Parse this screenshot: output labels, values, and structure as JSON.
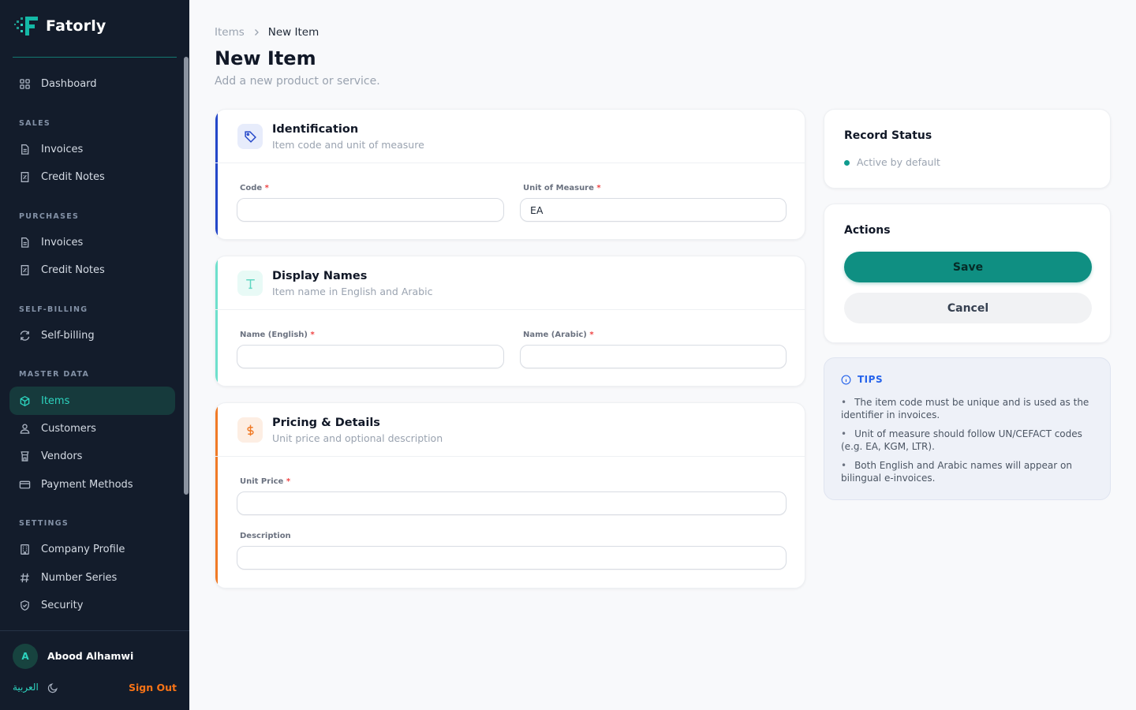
{
  "brand": {
    "name": "Fatorly"
  },
  "sidebar": {
    "dashboard": "Dashboard",
    "sections": {
      "sales": "SALES",
      "purchases": "PURCHASES",
      "self_billing": "SELF-BILLING",
      "master_data": "MASTER DATA",
      "settings": "SETTINGS"
    },
    "sales_items": [
      "Invoices",
      "Credit Notes"
    ],
    "purchase_items": [
      "Invoices",
      "Credit Notes"
    ],
    "self_billing_item": "Self-billing",
    "master_items": [
      "Items",
      "Customers",
      "Vendors",
      "Payment Methods"
    ],
    "settings_items": [
      "Company Profile",
      "Number Series",
      "Security"
    ],
    "active": "Items"
  },
  "user": {
    "initial": "A",
    "name": "Abood Alhamwi",
    "language_toggle": "العربية",
    "sign_out": "Sign Out"
  },
  "breadcrumb": {
    "parent": "Items",
    "current": "New Item"
  },
  "page": {
    "title": "New Item",
    "subtitle": "Add a new product or service."
  },
  "cards": {
    "identification": {
      "title": "Identification",
      "subtitle": "Item code and unit of measure",
      "code_label": "Code",
      "code_value": "",
      "uom_label": "Unit of Measure",
      "uom_value": "EA"
    },
    "display_names": {
      "title": "Display Names",
      "subtitle": "Item name in English and Arabic",
      "name_en_label": "Name (English)",
      "name_ar_label": "Name (Arabic)"
    },
    "pricing": {
      "title": "Pricing & Details",
      "subtitle": "Unit price and optional description",
      "unit_price_label": "Unit Price",
      "description_label": "Description"
    }
  },
  "record_status": {
    "title": "Record Status",
    "status": "Active by default"
  },
  "actions": {
    "title": "Actions",
    "save": "Save",
    "cancel": "Cancel"
  },
  "tips": {
    "title": "TIPS",
    "items": [
      "The item code must be unique and is used as the identifier in invoices.",
      "Unit of measure should follow UN/CEFACT codes (e.g. EA, KGM, LTR).",
      "Both English and Arabic names will appear on bilingual e-invoices."
    ]
  },
  "colors": {
    "sidebar_bg": "#131c2b",
    "accent_teal": "#0f8f82",
    "active_text": "#2dd4bf",
    "identification_accent": "#2447c9",
    "display_names_accent": "#6ee0cc",
    "pricing_accent": "#f07a26",
    "sign_out": "#f97316",
    "tips_title": "#2563eb"
  },
  "required_marker": "*"
}
